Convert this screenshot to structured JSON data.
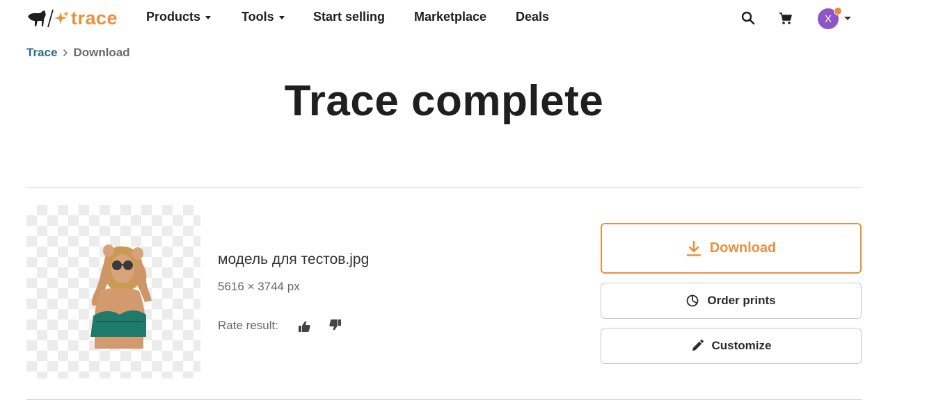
{
  "brand": {
    "name": "trace",
    "accent": "#e8913e"
  },
  "nav": {
    "products": "Products",
    "tools": "Tools",
    "start_selling": "Start selling",
    "marketplace": "Marketplace",
    "deals": "Deals"
  },
  "user": {
    "initial": "X",
    "avatar_color": "#8e55c9",
    "notification_color": "#ee8a36"
  },
  "breadcrumb": {
    "root": "Trace",
    "current": "Download"
  },
  "page": {
    "title": "Trace complete"
  },
  "result": {
    "file_name": "модель для тестов.jpg",
    "dimensions": "5616 × 3744 px",
    "rate_label": "Rate result:"
  },
  "actions": {
    "download": "Download",
    "order_prints": "Order prints",
    "customize": "Customize"
  },
  "icons": [
    "logo-horse-icon",
    "sparkle-icon",
    "search-icon",
    "cart-icon",
    "chevron-right-icon",
    "download-icon",
    "pie-chart-icon",
    "pencil-icon",
    "thumbs-up-icon",
    "thumbs-down-icon"
  ]
}
